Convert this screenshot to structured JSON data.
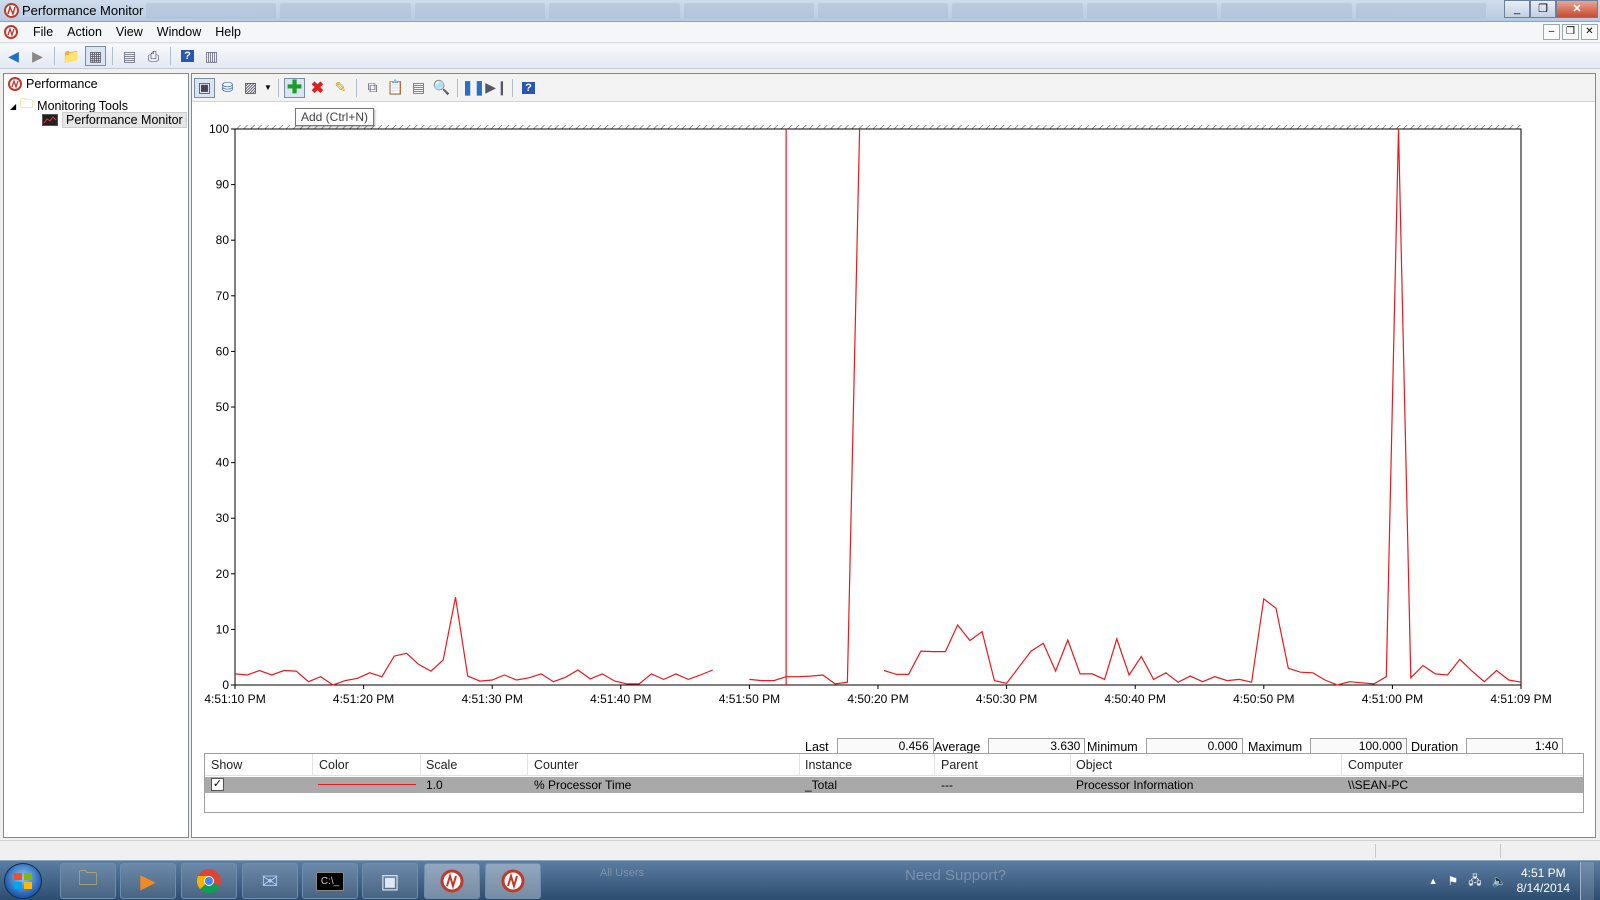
{
  "window": {
    "title": "Performance Monitor"
  },
  "menu": [
    "File",
    "Action",
    "View",
    "Window",
    "Help"
  ],
  "tree": {
    "root": "Performance",
    "group": "Monitoring Tools",
    "selected": "Performance Monitor"
  },
  "tooltip": "Add (Ctrl+N)",
  "stats": {
    "last_label": "Last",
    "last": "0.456",
    "average_label": "Average",
    "average": "3.630",
    "minimum_label": "Minimum",
    "minimum": "0.000",
    "maximum_label": "Maximum",
    "maximum": "100.000",
    "duration_label": "Duration",
    "duration": "1:40"
  },
  "legend": {
    "headers": [
      "Show",
      "Color",
      "Scale",
      "Counter",
      "Instance",
      "Parent",
      "Object",
      "Computer"
    ],
    "row": {
      "show": true,
      "color": "#e8191f",
      "scale": "1.0",
      "counter": "% Processor Time",
      "instance": "_Total",
      "parent": "---",
      "object": "Processor Information",
      "computer": "\\\\SEAN-PC"
    }
  },
  "taskbar": {
    "ghost_texts": [
      "All Users",
      "Need Support?"
    ],
    "clock_time": "4:51 PM",
    "clock_date": "8/14/2014"
  },
  "chart_data": {
    "type": "line",
    "ylim": [
      0,
      100
    ],
    "yticks": [
      0,
      10,
      20,
      30,
      40,
      50,
      60,
      70,
      80,
      90,
      100
    ],
    "xticks": [
      "4:51:10 PM",
      "4:51:20 PM",
      "4:51:30 PM",
      "4:51:40 PM",
      "4:51:50 PM",
      "4:50:20 PM",
      "4:50:30 PM",
      "4:50:40 PM",
      "4:50:50 PM",
      "4:51:00 PM",
      "4:51:09 PM"
    ],
    "current_position_index": 45,
    "series": [
      {
        "color": "#e8191f",
        "values": [
          2.0,
          1.8,
          2.6,
          1.8,
          2.6,
          2.5,
          0.6,
          1.5,
          0.0,
          0.8,
          1.2,
          2.2,
          1.5,
          5.2,
          5.7,
          3.7,
          2.5,
          4.5,
          15.8,
          1.6,
          0.7,
          0.9,
          1.8,
          0.9,
          1.3,
          2.0,
          0.6,
          1.4,
          2.7,
          1.1,
          2.0,
          0.7,
          0.2,
          0.2,
          2.0,
          1.0,
          2.0,
          1.0,
          1.8,
          2.7,
          null,
          null,
          1.0,
          0.8,
          0.8,
          1.5,
          1.5,
          1.6,
          1.8,
          0.2,
          0.5,
          100.0,
          null,
          2.6,
          1.9,
          1.9,
          6.1,
          6.0,
          6.0,
          10.8,
          8.0,
          9.6,
          0.8,
          0.3,
          3.2,
          6.1,
          7.5,
          2.5,
          8.1,
          2.0,
          2.0,
          1.0,
          8.3,
          1.8,
          5.1,
          1.0,
          2.2,
          0.5,
          1.6,
          0.6,
          1.5,
          0.8,
          1.0,
          0.5,
          15.5,
          13.8,
          3.0,
          2.3,
          2.2,
          0.9,
          0.0,
          0.6,
          0.4,
          0.2,
          1.5,
          100.0,
          1.3,
          3.5,
          2.0,
          1.8,
          4.6,
          2.5,
          0.6,
          2.6,
          0.9,
          0.5
        ]
      }
    ]
  }
}
